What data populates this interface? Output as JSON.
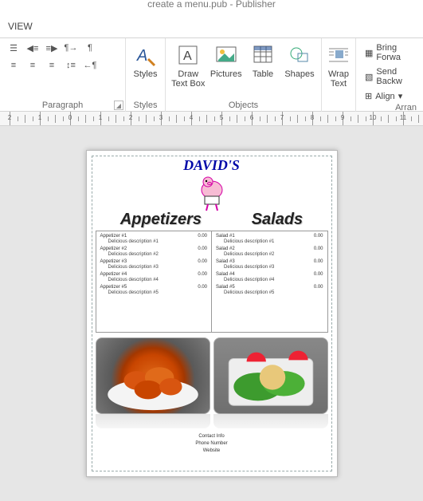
{
  "titlebar": "create a menu.pub - Publisher",
  "view_tab": "VIEW",
  "groups": {
    "paragraph": "Paragraph",
    "styles": "Styles",
    "styles_btn": "Styles",
    "objects": "Objects",
    "draw_textbox": "Draw\nText Box",
    "pictures": "Pictures",
    "table": "Table",
    "shapes": "Shapes",
    "wrap_text": "Wrap\nText",
    "arrange": "Arran",
    "bring_forward": "Bring Forwa",
    "send_backward": "Send Backw",
    "align": "Align"
  },
  "ruler_nums": [
    "2",
    "1",
    "0",
    "1",
    "2",
    "3",
    "4",
    "5",
    "6",
    "7",
    "8",
    "9",
    "10",
    "11"
  ],
  "menu": {
    "logo_text": "DAVID'S",
    "left_head": "Appetizers",
    "right_head": "Salads",
    "left_items": [
      {
        "name": "Appetizer #1",
        "price": "0.00",
        "desc": "Delicious description #1"
      },
      {
        "name": "Appetizer #2",
        "price": "0.00",
        "desc": "Delicious description #2"
      },
      {
        "name": "Appetizer #3",
        "price": "0.00",
        "desc": "Delicious description #3"
      },
      {
        "name": "Appetizer #4",
        "price": "0.00",
        "desc": "Delicious description #4"
      },
      {
        "name": "Appetizer #5",
        "price": "0.00",
        "desc": "Delicious description #5"
      }
    ],
    "right_items": [
      {
        "name": "Salad #1",
        "price": "0.00",
        "desc": "Delicious description #1"
      },
      {
        "name": "Salad #2",
        "price": "0.00",
        "desc": "Delicious description #2"
      },
      {
        "name": "Salad #3",
        "price": "0.00",
        "desc": "Delicious description #3"
      },
      {
        "name": "Salad #4",
        "price": "0.00",
        "desc": "Delicious description #4"
      },
      {
        "name": "Salad #5",
        "price": "0.00",
        "desc": "Delicious description #5"
      }
    ],
    "contact": [
      "Contact Info",
      "Phone Number",
      "Website"
    ]
  }
}
